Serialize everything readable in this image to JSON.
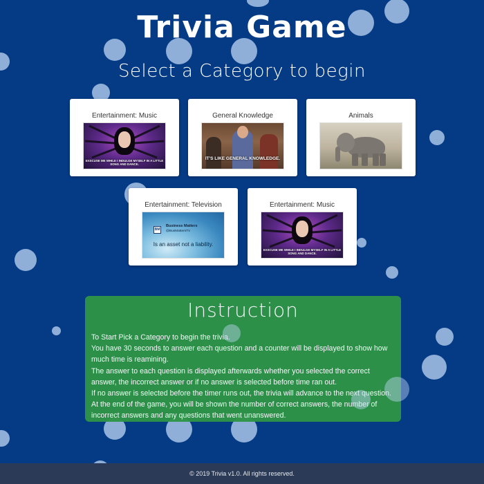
{
  "page": {
    "title": "Trivia Game",
    "subtitle": "Select a Category to begin"
  },
  "categories": [
    {
      "label": "Entertainment: Music",
      "image": "spider-costume-singer",
      "caption": "EXSCUSE ME WHILE I INDULGE MYSELF IN A LITTLE SONG AND DANCE."
    },
    {
      "label": "General Knowledge",
      "image": "tv-show-scene",
      "caption": "IT'S LIKE GENERAL KNOWLEDGE."
    },
    {
      "label": "Animals",
      "image": "elephant",
      "caption": ""
    },
    {
      "label": "Entertainment: Television",
      "image": "water-tweet",
      "handle_name": "Business Matters",
      "handle_at": "@BusMattersTV",
      "caption": "Is an asset not a liability."
    },
    {
      "label": "Entertainment: Music",
      "image": "spider-costume-singer",
      "caption": "EXSCUSE ME WHILE I INDULGE MYSELF IN A LITTLE SONG AND DANCE."
    }
  ],
  "instruction": {
    "heading": "Instruction",
    "lines": [
      "To Start Pick a Category to begin the trivia.",
      "You have 30 seconds to answer each question and a counter will be displayed to show how much time is reamining.",
      "The answer to each question is displayed afterwards whether you selected the correct answer, the incorrect answer or if no answer is selected before time ran out.",
      "If no answer is selected before the timer runs out, the trivia will advance to the next question. At the end of the game, you will be shown the number of correct answers, the number of incorrect answers and any questions that went unanswered."
    ]
  },
  "footer": {
    "copyright": "© 2019 Trivia v1.0. All rights reserved."
  },
  "colors": {
    "background": "#053a85",
    "bubble": "#bed7f5",
    "instruction_panel": "#2e9446",
    "footer": "#2b3a56",
    "card": "#ffffff"
  }
}
